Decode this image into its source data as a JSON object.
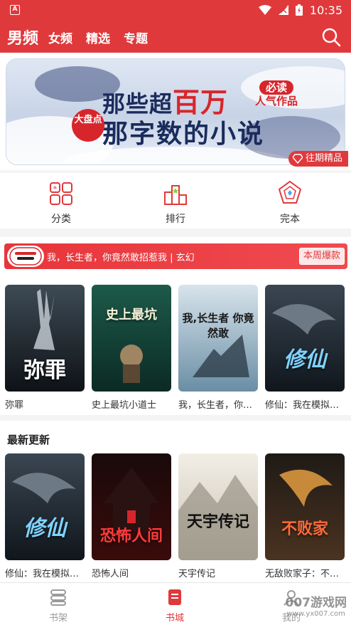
{
  "status_bar": {
    "time": "10:35",
    "app_badge": "A"
  },
  "header": {
    "tabs": [
      {
        "label": "男频",
        "active": true
      },
      {
        "label": "女频"
      },
      {
        "label": "精选"
      },
      {
        "label": "专题"
      }
    ],
    "search_icon": "search-icon"
  },
  "banner": {
    "line1_a": "那些超",
    "line1_b": "百万",
    "line2": "那字数的小说",
    "seal": "大盘点",
    "tag_top": "必读",
    "tag_bottom": "人气作品",
    "past_label": "往期精品",
    "dots": 8,
    "active_dot": 0
  },
  "categories": [
    {
      "label": "分类",
      "icon": "category-grid-icon"
    },
    {
      "label": "排行",
      "icon": "ranking-bars-icon"
    },
    {
      "label": "完本",
      "icon": "pentagon-badge-icon"
    }
  ],
  "hot_strip": {
    "logo_text": "书荒少年\n必读清单",
    "text": "我，长生者，你竟然敢招惹我 | 玄幻",
    "week_label": "本周爆款"
  },
  "hot_books": [
    {
      "title": "弥罪",
      "cover_text": "弥罪"
    },
    {
      "title": "史上最坑小道士",
      "cover_text": "史上最坑"
    },
    {
      "title": "我，长生者，你竟然敢招惹我",
      "cover_text": "我,长生者 你竟然敢"
    },
    {
      "title": "修仙：我在模拟器里修仙",
      "cover_text": "修仙"
    }
  ],
  "latest": {
    "heading": "最新更新",
    "books": [
      {
        "title": "修仙：我在模拟器里修仙",
        "cover_text": "修仙"
      },
      {
        "title": "恐怖人间",
        "cover_text": "恐怖人间"
      },
      {
        "title": "天宇传记",
        "cover_text": "天宇传记"
      },
      {
        "title": "无敌败家子：不可能的事",
        "cover_text": "不败家"
      }
    ]
  },
  "tabbar": [
    {
      "label": "书架",
      "icon": "bookshelf-icon",
      "active": false
    },
    {
      "label": "书城",
      "icon": "bookstore-icon",
      "active": true
    },
    {
      "label": "我的",
      "icon": "profile-icon",
      "active": false
    }
  ],
  "watermark": {
    "main": "007游戏网",
    "sub": "www.yx007.com"
  },
  "colors": {
    "brand": "#e0393c",
    "inactive": "#9a9a9a"
  }
}
